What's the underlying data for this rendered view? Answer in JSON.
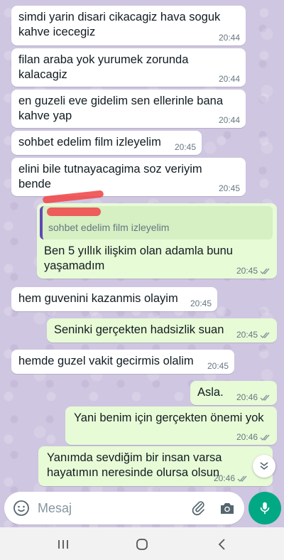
{
  "messages": [
    {
      "text": "simdi yarin disari cikacagiz hava soguk kahve icecegiz",
      "time": "20:44",
      "dir": "in"
    },
    {
      "text": "filan araba yok yurumek zorunda kalacagiz",
      "time": "20:44",
      "dir": "in"
    },
    {
      "text": "en guzeli eve gidelim sen ellerinle bana kahve yap",
      "time": "20:44",
      "dir": "in"
    },
    {
      "text": "sohbet edelim film izleyelim",
      "time": "20:45",
      "dir": "in"
    },
    {
      "text": "elini bile tutnayacagima soz veriyim bende",
      "time": "20:45",
      "dir": "in"
    },
    {
      "quote": "sohbet edelim film izleyelim",
      "text": "Ben 5 yıllık ilişkim olan adamla bunu yaşamadım",
      "time": "20:45",
      "dir": "out"
    },
    {
      "text": "hem guvenini kazanmis olayim",
      "time": "20:45",
      "dir": "in"
    },
    {
      "text": "Seninki gerçekten hadsizlik suan",
      "time": "20:45",
      "dir": "out"
    },
    {
      "text": "hemde guzel vakit gecirmis olalim",
      "time": "20:45",
      "dir": "in"
    },
    {
      "text": "Asla.",
      "time": "20:46",
      "dir": "out"
    },
    {
      "text": "Yani benim için gerçekten önemi yok",
      "time": "20:46",
      "dir": "out"
    },
    {
      "text": "Yanımda sevdiğim bir insan varsa hayatımın neresinde olursa olsun",
      "time": "20:46",
      "dir": "out"
    }
  ],
  "input": {
    "placeholder": "Mesaj"
  },
  "icons": {
    "emoji": "emoji-icon",
    "attach": "paperclip-icon",
    "camera": "camera-icon",
    "mic": "microphone-icon",
    "scroll": "double-chevron-down-icon",
    "read": "double-check-icon"
  },
  "colors": {
    "incoming_bubble": "#ffffff",
    "outgoing_bubble": "#e7fbd6",
    "accent": "#00a884",
    "wallpaper": "#cfc6e1"
  }
}
